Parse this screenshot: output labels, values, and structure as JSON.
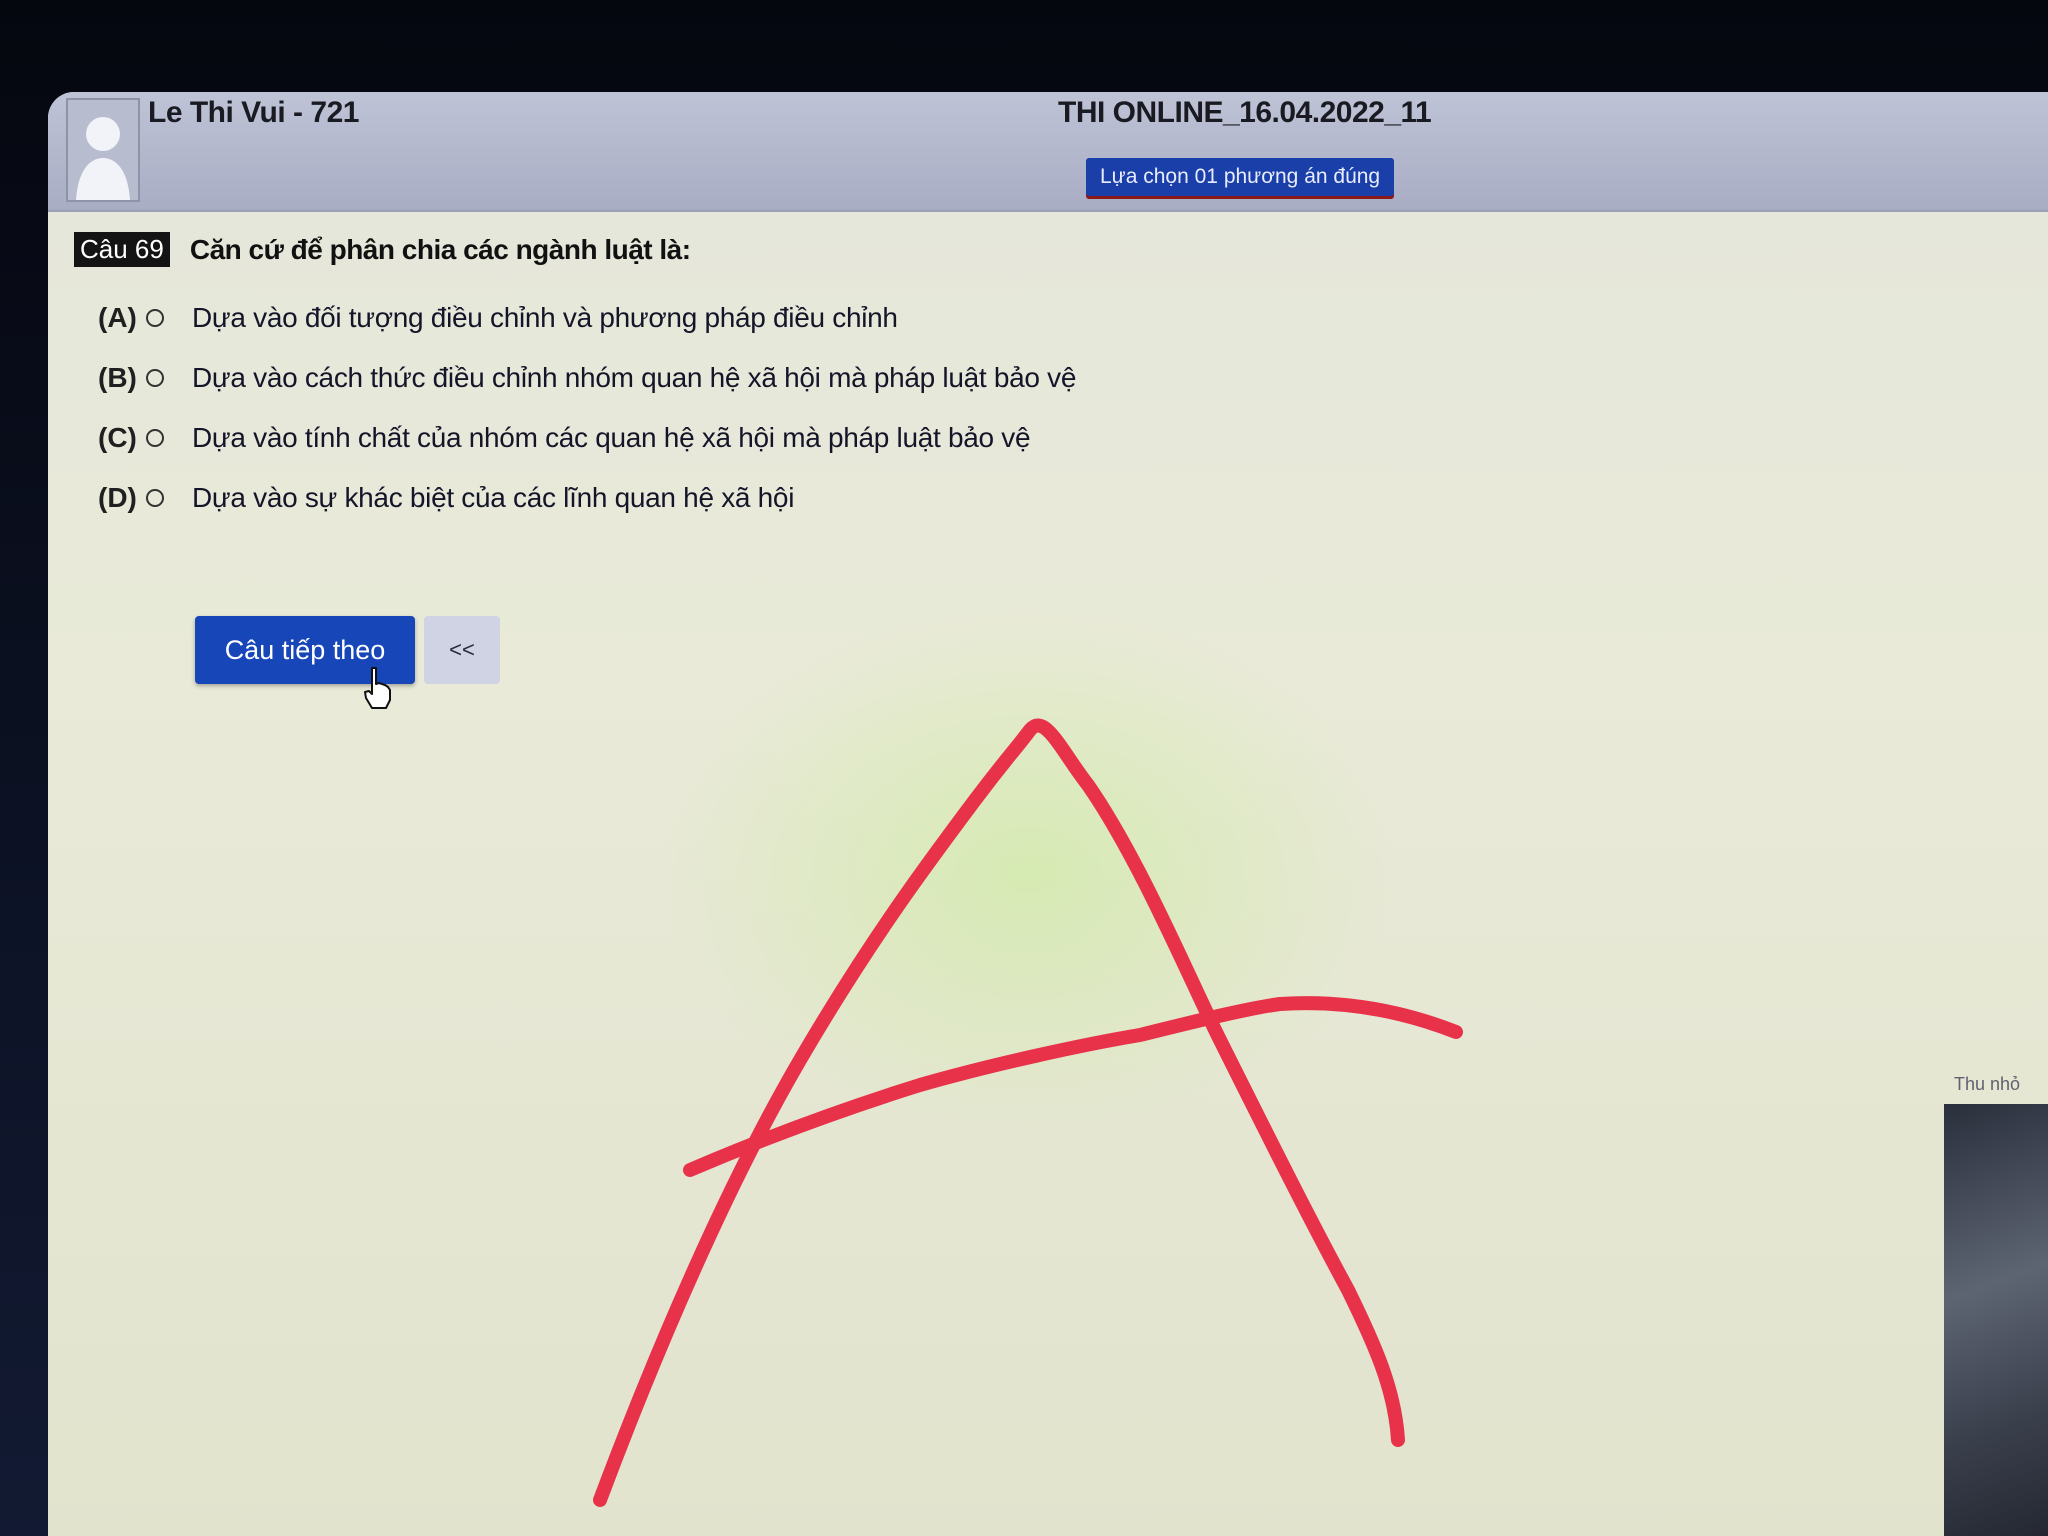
{
  "header": {
    "student_name": "Le Thi Vui - 721",
    "exam_title": "THI ONLINE_16.04.2022_11",
    "instruction": "Lựa chọn 01 phương án đúng"
  },
  "question": {
    "number_label": "Câu 69",
    "text": "Căn cứ để phân chia các ngành luật là:",
    "options": [
      {
        "letter": "(A)",
        "text": "Dựa vào đối tượng điều chỉnh và phương pháp điều chỉnh"
      },
      {
        "letter": "(B)",
        "text": "Dựa vào cách thức điều chỉnh nhóm quan hệ xã hội mà pháp luật bảo vệ"
      },
      {
        "letter": "(C)",
        "text": "Dựa vào tính chất của nhóm các quan hệ xã hội mà pháp luật bảo vệ"
      },
      {
        "letter": "(D)",
        "text": "Dựa vào sự khác biệt của các lĩnh quan hệ xã hội"
      }
    ]
  },
  "navigation": {
    "next_label": "Câu tiếp theo",
    "prev_label": "<<"
  },
  "webcam": {
    "minimize_label": "Thu nhỏ"
  },
  "icons": {
    "avatar": "user-silhouette-icon",
    "cursor": "hand-pointer-icon",
    "radio": "radio-unchecked-icon"
  },
  "colors": {
    "primary_button": "#1746b8",
    "badge": "#1a3fa8",
    "annotation": "#e8324a"
  }
}
